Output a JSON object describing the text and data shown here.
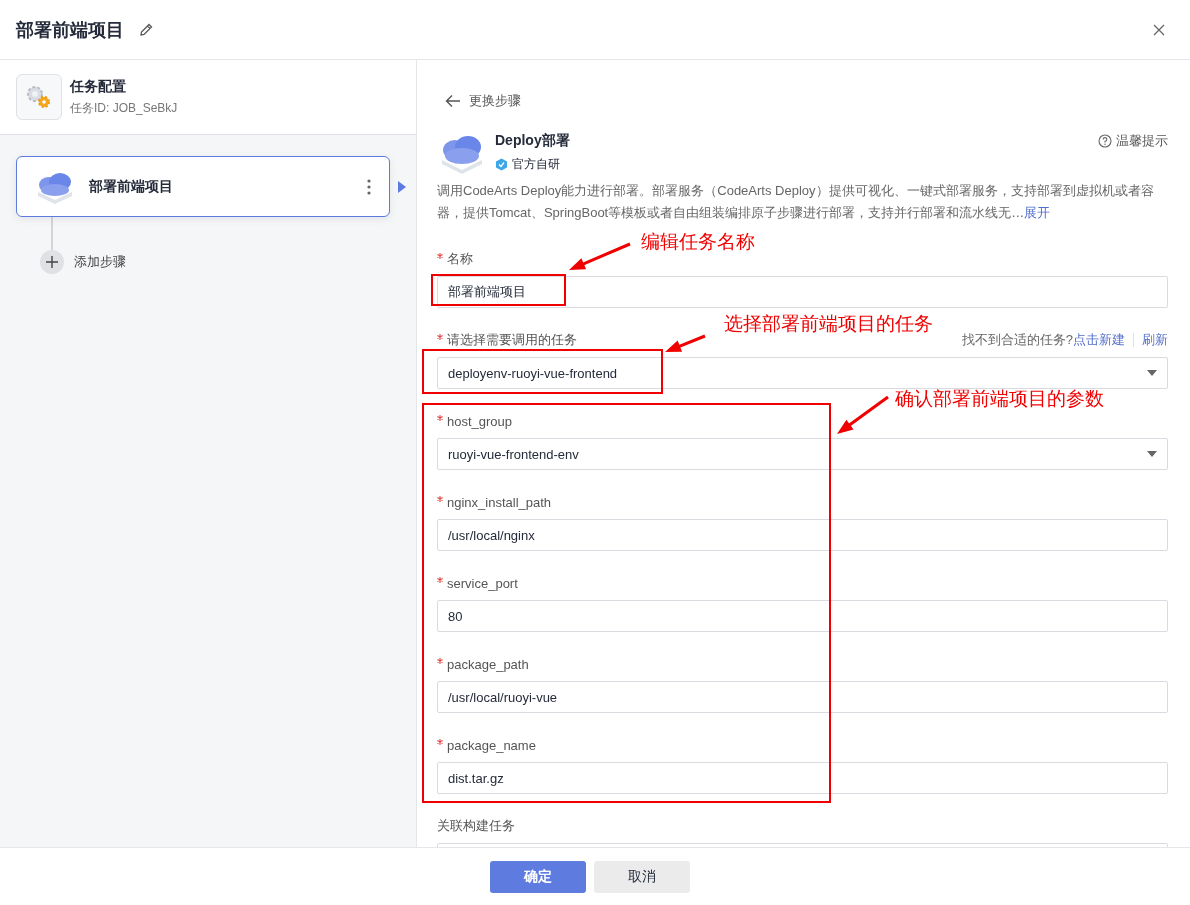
{
  "dialog": {
    "title": "部署前端项目"
  },
  "sidebar": {
    "task_config": {
      "title": "任务配置",
      "task_id": "任务ID: JOB_SeBkJ"
    },
    "steps": [
      {
        "name": "部署前端项目",
        "selected": true
      }
    ],
    "add_step": "添加步骤"
  },
  "step_panel": {
    "back_link": "更换步骤",
    "plugin": {
      "name": "Deploy部署",
      "badge": "官方自研",
      "tip": "温馨提示",
      "description": "调用CodeArts Deploy能力进行部署。部署服务（CodeArts Deploy）提供可视化、一键式部署服务，支持部署到虚拟机或者容器，提供Tomcat、SpringBoot等模板或者自由组装编排原子步骤进行部署，支持并行部署和流水线无…",
      "expand": "展开"
    },
    "links": {
      "hint": "找不到合适的任务?",
      "create": "点击新建",
      "refresh": "刷新"
    },
    "fields": [
      {
        "label": "名称",
        "required": true,
        "kind": "input",
        "value": "部署前端项目"
      },
      {
        "label": "请选择需要调用的任务",
        "required": true,
        "kind": "select",
        "value": "deployenv-ruoyi-vue-frontend"
      },
      {
        "label": "host_group",
        "required": true,
        "kind": "select",
        "value": "ruoyi-vue-frontend-env"
      },
      {
        "label": "nginx_install_path",
        "required": true,
        "kind": "input",
        "value": "/usr/local/nginx"
      },
      {
        "label": "service_port",
        "required": true,
        "kind": "input",
        "value": "80"
      },
      {
        "label": "package_path",
        "required": true,
        "kind": "input",
        "value": "/usr/local/ruoyi-vue"
      },
      {
        "label": "package_name",
        "required": true,
        "kind": "input",
        "value": "dist.tar.gz"
      },
      {
        "label": "关联构建任务",
        "required": false,
        "kind": "input"
      }
    ]
  },
  "footer": {
    "buttons": [
      {
        "label": "确定",
        "kind": "primary"
      },
      {
        "label": "取消",
        "kind": "default"
      }
    ]
  },
  "annotations": [
    "编辑任务名称",
    "选择部署前端项目的任务",
    "确认部署前端项目的参数"
  ]
}
